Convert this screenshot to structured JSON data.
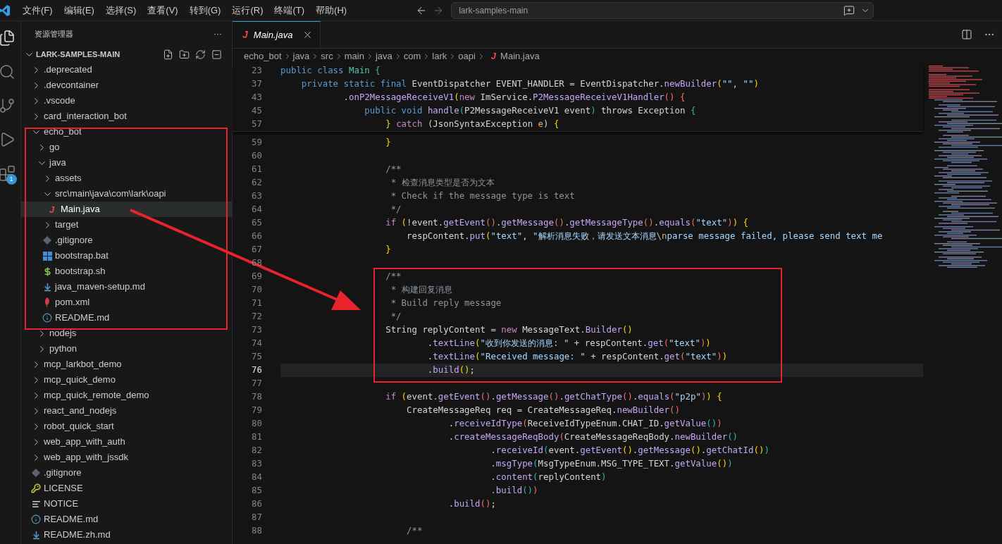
{
  "menu": [
    "文件(F)",
    "编辑(E)",
    "选择(S)",
    "查看(V)",
    "转到(G)",
    "运行(R)",
    "终端(T)",
    "帮助(H)"
  ],
  "command_center": {
    "value": "lark-samples-main"
  },
  "activity_bar": [
    {
      "kind": "explorer",
      "selected": true
    },
    {
      "kind": "search",
      "selected": false
    },
    {
      "kind": "source-control",
      "selected": false
    },
    {
      "kind": "run-debug",
      "selected": false
    },
    {
      "kind": "extensions",
      "selected": false,
      "badge": "1"
    }
  ],
  "sidebar": {
    "title": "资源管理器",
    "more": "···",
    "project": "LARK-SAMPLES-MAIN",
    "project_expanded": true,
    "tree": [
      {
        "name": ".deprecated",
        "kind": "folder",
        "expanded": false,
        "selected": false
      },
      {
        "name": ".devcontainer",
        "kind": "folder",
        "expanded": false,
        "selected": false
      },
      {
        "name": ".vscode",
        "kind": "folder",
        "expanded": false,
        "selected": false
      },
      {
        "name": "card_interaction_bot",
        "kind": "folder",
        "expanded": false,
        "selected": false
      },
      {
        "name": "echo_bot",
        "kind": "folder",
        "expanded": true,
        "selected": false,
        "children": [
          {
            "name": "go",
            "kind": "folder",
            "expanded": false,
            "selected": false
          },
          {
            "name": "java",
            "kind": "folder",
            "expanded": true,
            "selected": false,
            "children": [
              {
                "name": "assets",
                "kind": "folder",
                "expanded": false,
                "selected": false
              },
              {
                "name": "src\\main\\java\\com\\lark\\oapi",
                "kind": "folder",
                "expanded": true,
                "selected": false,
                "children": [
                  {
                    "name": "Main.java",
                    "kind": "java",
                    "glyph": "J",
                    "selected": true
                  }
                ]
              },
              {
                "name": "target",
                "kind": "folder",
                "expanded": false,
                "selected": false
              },
              {
                "name": ".gitignore",
                "kind": "git",
                "selected": false
              },
              {
                "name": "bootstrap.bat",
                "kind": "windows",
                "selected": false
              },
              {
                "name": "bootstrap.sh",
                "kind": "shell",
                "selected": false
              },
              {
                "name": "java_maven-setup.md",
                "kind": "download",
                "selected": false
              },
              {
                "name": "pom.xml",
                "kind": "pom",
                "selected": false
              },
              {
                "name": "README.md",
                "kind": "info",
                "selected": false
              }
            ]
          },
          {
            "name": "nodejs",
            "kind": "folder",
            "expanded": false,
            "selected": false
          },
          {
            "name": "python",
            "kind": "folder",
            "expanded": false,
            "selected": false
          }
        ]
      },
      {
        "name": "mcp_larkbot_demo",
        "kind": "folder",
        "expanded": false,
        "selected": false
      },
      {
        "name": "mcp_quick_demo",
        "kind": "folder",
        "expanded": false,
        "selected": false
      },
      {
        "name": "mcp_quick_remote_demo",
        "kind": "folder",
        "expanded": false,
        "selected": false
      },
      {
        "name": "react_and_nodejs",
        "kind": "folder",
        "expanded": false,
        "selected": false
      },
      {
        "name": "robot_quick_start",
        "kind": "folder",
        "expanded": false,
        "selected": false
      },
      {
        "name": "web_app_with_auth",
        "kind": "folder",
        "expanded": false,
        "selected": false
      },
      {
        "name": "web_app_with_jssdk",
        "kind": "folder",
        "expanded": false,
        "selected": false
      },
      {
        "name": ".gitignore",
        "kind": "git",
        "selected": false
      },
      {
        "name": "LICENSE",
        "kind": "license",
        "selected": false
      },
      {
        "name": "NOTICE",
        "kind": "lines",
        "selected": false
      },
      {
        "name": "README.md",
        "kind": "info",
        "selected": false
      },
      {
        "name": "README.zh.md",
        "kind": "download",
        "selected": false
      }
    ]
  },
  "tabs": [
    {
      "label": "Main.java",
      "glyph": "J",
      "selected": true,
      "italic": true
    }
  ],
  "breadcrumbs": [
    {
      "label": "echo_bot"
    },
    {
      "label": "java"
    },
    {
      "label": "src"
    },
    {
      "label": "main"
    },
    {
      "label": "java"
    },
    {
      "label": "com"
    },
    {
      "label": "lark"
    },
    {
      "label": "oapi"
    },
    {
      "label": "Main.java",
      "glyph": "J"
    }
  ],
  "sticky_lines": [
    {
      "number": "23",
      "tokens": [
        {
          "text": "public class ",
          "kind": "kw"
        },
        {
          "text": "Main ",
          "kind": "type"
        },
        {
          "text": "{",
          "kind": "b3"
        }
      ]
    },
    {
      "number": "37",
      "tokens": [
        {
          "text": "    private static final ",
          "kind": "kw"
        },
        {
          "text": "EventDispatcher EVENT_HANDLER = EventDispatcher.",
          "kind": "plain"
        },
        {
          "text": "newBuilder",
          "kind": "fn"
        },
        {
          "text": "(",
          "kind": "b1"
        },
        {
          "text": "\"\", \"\"",
          "kind": "str"
        },
        {
          "text": ")",
          "kind": "b1"
        }
      ]
    },
    {
      "number": "43",
      "tokens": [
        {
          "text": "            .",
          "kind": "plain"
        },
        {
          "text": "onP2MessageReceiveV1",
          "kind": "fn"
        },
        {
          "text": "(",
          "kind": "b1"
        },
        {
          "text": "new ",
          "kind": "ctrl"
        },
        {
          "text": "ImService.",
          "kind": "plain"
        },
        {
          "text": "P2MessageReceiveV1Handler",
          "kind": "fn"
        },
        {
          "text": "() {",
          "kind": "b2"
        }
      ]
    },
    {
      "number": "45",
      "tokens": [
        {
          "text": "                public void ",
          "kind": "kw"
        },
        {
          "text": "handle",
          "kind": "fn"
        },
        {
          "text": "(",
          "kind": "b3"
        },
        {
          "text": "P2MessageReceiveV1 event",
          "kind": "plain"
        },
        {
          "text": ")",
          "kind": "b3"
        },
        {
          "text": " throws Exception ",
          "kind": "plain"
        },
        {
          "text": "{",
          "kind": "b3"
        }
      ]
    },
    {
      "number": "57",
      "tokens": [
        {
          "text": "                    } ",
          "kind": "b1"
        },
        {
          "text": "catch ",
          "kind": "ctrl"
        },
        {
          "text": "(JsonSyntaxException ",
          "kind": "plain"
        },
        {
          "text": "e",
          "kind": "param"
        },
        {
          "text": ") ",
          "kind": "plain"
        },
        {
          "text": "{",
          "kind": "b1"
        }
      ]
    }
  ],
  "lines": [
    {
      "number": "59",
      "current": false,
      "tokens": [
        {
          "text": "                    }",
          "kind": "b1"
        }
      ]
    },
    {
      "number": "60",
      "current": false
    },
    {
      "number": "61",
      "current": false,
      "tokens": [
        {
          "text": "                    /**",
          "kind": "com"
        }
      ]
    },
    {
      "number": "62",
      "current": false,
      "tokens": [
        {
          "text": "                     * 检查消息类型是否为文本",
          "kind": "com"
        }
      ]
    },
    {
      "number": "63",
      "current": false,
      "tokens": [
        {
          "text": "                     * Check if the message type is text",
          "kind": "com"
        }
      ]
    },
    {
      "number": "64",
      "current": false,
      "tokens": [
        {
          "text": "                     */",
          "kind": "com"
        }
      ]
    },
    {
      "number": "65",
      "current": false,
      "tokens": [
        {
          "text": "                    if ",
          "kind": "ctrl"
        },
        {
          "text": "(",
          "kind": "b1"
        },
        {
          "text": "!event.",
          "kind": "plain"
        },
        {
          "text": "getEvent",
          "kind": "fn"
        },
        {
          "text": "()",
          "kind": "b2"
        },
        {
          "text": ".",
          "kind": "plain"
        },
        {
          "text": "getMessage",
          "kind": "fn"
        },
        {
          "text": "()",
          "kind": "b2"
        },
        {
          "text": ".",
          "kind": "plain"
        },
        {
          "text": "getMessageType",
          "kind": "fn"
        },
        {
          "text": "()",
          "kind": "b2"
        },
        {
          "text": ".",
          "kind": "plain"
        },
        {
          "text": "equals",
          "kind": "fn"
        },
        {
          "text": "(",
          "kind": "b2"
        },
        {
          "text": "\"text\"",
          "kind": "str"
        },
        {
          "text": ")",
          "kind": "b2"
        },
        {
          "text": ") {",
          "kind": "b1"
        }
      ]
    },
    {
      "number": "66",
      "current": false,
      "tokens": [
        {
          "text": "                        respContent.",
          "kind": "plain"
        },
        {
          "text": "put",
          "kind": "fn"
        },
        {
          "text": "(",
          "kind": "b1"
        },
        {
          "text": "\"text\"",
          "kind": "str"
        },
        {
          "text": ", ",
          "kind": "plain"
        },
        {
          "text": "\"解析消息失败，请发送文本消息",
          "kind": "str"
        },
        {
          "text": "\\n",
          "kind": "esc"
        },
        {
          "text": "parse message failed, please send text me",
          "kind": "str"
        }
      ]
    },
    {
      "number": "67",
      "current": false,
      "tokens": [
        {
          "text": "                    }",
          "kind": "b1"
        }
      ]
    },
    {
      "number": "68",
      "current": false
    },
    {
      "number": "69",
      "current": false,
      "tokens": [
        {
          "text": "                    /**",
          "kind": "com"
        }
      ]
    },
    {
      "number": "70",
      "current": false,
      "tokens": [
        {
          "text": "                     * 构建回复消息",
          "kind": "com"
        }
      ]
    },
    {
      "number": "71",
      "current": false,
      "tokens": [
        {
          "text": "                     * Build reply message",
          "kind": "com"
        }
      ]
    },
    {
      "number": "72",
      "current": false,
      "tokens": [
        {
          "text": "                     */",
          "kind": "com"
        }
      ]
    },
    {
      "number": "73",
      "current": false,
      "tokens": [
        {
          "text": "                    String replyContent = ",
          "kind": "plain"
        },
        {
          "text": "new ",
          "kind": "ctrl"
        },
        {
          "text": "MessageText.",
          "kind": "plain"
        },
        {
          "text": "Builder",
          "kind": "fn"
        },
        {
          "text": "()",
          "kind": "b1"
        }
      ]
    },
    {
      "number": "74",
      "current": false,
      "tokens": [
        {
          "text": "                            .",
          "kind": "plain"
        },
        {
          "text": "textLine",
          "kind": "fn"
        },
        {
          "text": "(",
          "kind": "b1"
        },
        {
          "text": "\"收到你发送的消息: \"",
          "kind": "str"
        },
        {
          "text": " + respContent.",
          "kind": "plain"
        },
        {
          "text": "get",
          "kind": "fn"
        },
        {
          "text": "(",
          "kind": "b2"
        },
        {
          "text": "\"text\"",
          "kind": "str"
        },
        {
          "text": ")",
          "kind": "b2"
        },
        {
          "text": ")",
          "kind": "b1"
        }
      ]
    },
    {
      "number": "75",
      "current": false,
      "tokens": [
        {
          "text": "                            .",
          "kind": "plain"
        },
        {
          "text": "textLine",
          "kind": "fn"
        },
        {
          "text": "(",
          "kind": "b1"
        },
        {
          "text": "\"Received message: \"",
          "kind": "str"
        },
        {
          "text": " + respContent.",
          "kind": "plain"
        },
        {
          "text": "get",
          "kind": "fn"
        },
        {
          "text": "(",
          "kind": "b2"
        },
        {
          "text": "\"text\"",
          "kind": "str"
        },
        {
          "text": ")",
          "kind": "b2"
        },
        {
          "text": ")",
          "kind": "b1"
        }
      ]
    },
    {
      "number": "76",
      "current": true,
      "tokens": [
        {
          "text": "                            .",
          "kind": "plain"
        },
        {
          "text": "build",
          "kind": "fn"
        },
        {
          "text": "()",
          "kind": "b1"
        },
        {
          "text": ";",
          "kind": "plain"
        }
      ]
    },
    {
      "number": "77",
      "current": false
    },
    {
      "number": "78",
      "current": false,
      "tokens": [
        {
          "text": "                    if ",
          "kind": "ctrl"
        },
        {
          "text": "(",
          "kind": "b1"
        },
        {
          "text": "event.",
          "kind": "plain"
        },
        {
          "text": "getEvent",
          "kind": "fn"
        },
        {
          "text": "()",
          "kind": "b2"
        },
        {
          "text": ".",
          "kind": "plain"
        },
        {
          "text": "getMessage",
          "kind": "fn"
        },
        {
          "text": "()",
          "kind": "b2"
        },
        {
          "text": ".",
          "kind": "plain"
        },
        {
          "text": "getChatType",
          "kind": "fn"
        },
        {
          "text": "()",
          "kind": "b2"
        },
        {
          "text": ".",
          "kind": "plain"
        },
        {
          "text": "equals",
          "kind": "fn"
        },
        {
          "text": "(",
          "kind": "b2"
        },
        {
          "text": "\"p2p\"",
          "kind": "str"
        },
        {
          "text": ")",
          "kind": "b2"
        },
        {
          "text": ") {",
          "kind": "b1"
        }
      ]
    },
    {
      "number": "79",
      "current": false,
      "tokens": [
        {
          "text": "                        CreateMessageReq req = CreateMessageReq.",
          "kind": "plain"
        },
        {
          "text": "newBuilder",
          "kind": "fn"
        },
        {
          "text": "()",
          "kind": "b2"
        }
      ]
    },
    {
      "number": "80",
      "current": false,
      "tokens": [
        {
          "text": "                                .",
          "kind": "plain"
        },
        {
          "text": "receiveIdType",
          "kind": "fn"
        },
        {
          "text": "(",
          "kind": "b2"
        },
        {
          "text": "ReceiveIdTypeEnum.CHAT_ID.",
          "kind": "plain"
        },
        {
          "text": "getValue",
          "kind": "fn"
        },
        {
          "text": "()",
          "kind": "b3"
        },
        {
          "text": ")",
          "kind": "b2"
        }
      ]
    },
    {
      "number": "81",
      "current": false,
      "tokens": [
        {
          "text": "                                .",
          "kind": "plain"
        },
        {
          "text": "createMessageReqBody",
          "kind": "fn"
        },
        {
          "text": "(",
          "kind": "b2"
        },
        {
          "text": "CreateMessageReqBody.",
          "kind": "plain"
        },
        {
          "text": "newBuilder",
          "kind": "fn"
        },
        {
          "text": "()",
          "kind": "b3"
        }
      ]
    },
    {
      "number": "82",
      "current": false,
      "tokens": [
        {
          "text": "                                        .",
          "kind": "plain"
        },
        {
          "text": "receiveId",
          "kind": "fn"
        },
        {
          "text": "(",
          "kind": "b3"
        },
        {
          "text": "event.",
          "kind": "plain"
        },
        {
          "text": "getEvent",
          "kind": "fn"
        },
        {
          "text": "()",
          "kind": "b1"
        },
        {
          "text": ".",
          "kind": "plain"
        },
        {
          "text": "getMessage",
          "kind": "fn"
        },
        {
          "text": "()",
          "kind": "b1"
        },
        {
          "text": ".",
          "kind": "plain"
        },
        {
          "text": "getChatId",
          "kind": "fn"
        },
        {
          "text": "()",
          "kind": "b1"
        },
        {
          "text": ")",
          "kind": "b3"
        }
      ]
    },
    {
      "number": "83",
      "current": false,
      "tokens": [
        {
          "text": "                                        .",
          "kind": "plain"
        },
        {
          "text": "msgType",
          "kind": "fn"
        },
        {
          "text": "(",
          "kind": "b3"
        },
        {
          "text": "MsgTypeEnum.MSG_TYPE_TEXT.",
          "kind": "plain"
        },
        {
          "text": "getValue",
          "kind": "fn"
        },
        {
          "text": "()",
          "kind": "b1"
        },
        {
          "text": ")",
          "kind": "b3"
        }
      ]
    },
    {
      "number": "84",
      "current": false,
      "tokens": [
        {
          "text": "                                        .",
          "kind": "plain"
        },
        {
          "text": "content",
          "kind": "fn"
        },
        {
          "text": "(",
          "kind": "b3"
        },
        {
          "text": "replyContent",
          "kind": "plain"
        },
        {
          "text": ")",
          "kind": "b3"
        }
      ]
    },
    {
      "number": "85",
      "current": false,
      "tokens": [
        {
          "text": "                                        .build",
          "kind": "fn"
        },
        {
          "text": "()",
          "kind": "b3"
        },
        {
          "text": ")",
          "kind": "b2"
        }
      ]
    },
    {
      "number": "86",
      "current": false,
      "tokens": [
        {
          "text": "                                .",
          "kind": "plain"
        },
        {
          "text": "build",
          "kind": "fn"
        },
        {
          "text": "()",
          "kind": "b2"
        },
        {
          "text": ";",
          "kind": "plain"
        }
      ]
    },
    {
      "number": "87",
      "current": false
    },
    {
      "number": "88",
      "current": false,
      "tokens": [
        {
          "text": "                        /**",
          "kind": "com"
        }
      ]
    }
  ]
}
